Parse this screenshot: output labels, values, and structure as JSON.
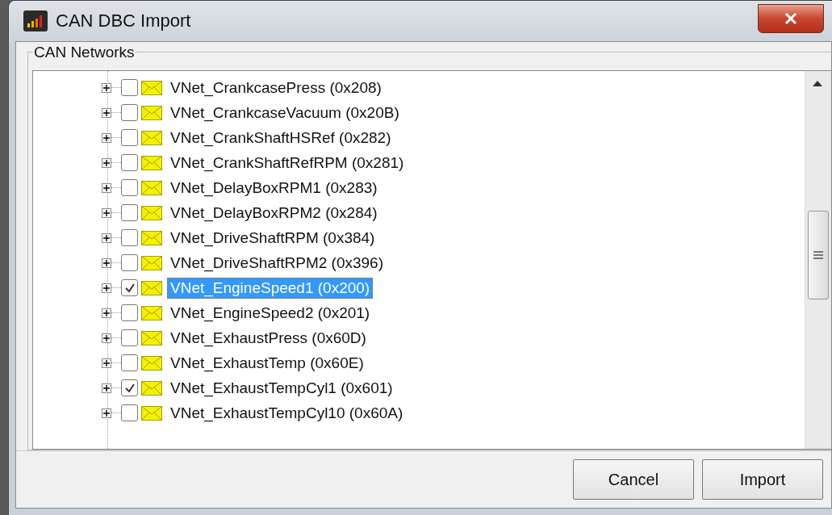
{
  "window": {
    "title": "CAN DBC Import"
  },
  "group": {
    "label": "CAN Networks"
  },
  "tree": {
    "items": [
      {
        "label": "VNet_CrankcasePress (0x208)",
        "checked": false,
        "selected": false,
        "expanded": false
      },
      {
        "label": "VNet_CrankcaseVacuum (0x20B)",
        "checked": false,
        "selected": false,
        "expanded": false
      },
      {
        "label": "VNet_CrankShaftHSRef (0x282)",
        "checked": false,
        "selected": false,
        "expanded": false
      },
      {
        "label": "VNet_CrankShaftRefRPM (0x281)",
        "checked": false,
        "selected": false,
        "expanded": false
      },
      {
        "label": "VNet_DelayBoxRPM1 (0x283)",
        "checked": false,
        "selected": false,
        "expanded": false
      },
      {
        "label": "VNet_DelayBoxRPM2 (0x284)",
        "checked": false,
        "selected": false,
        "expanded": false
      },
      {
        "label": "VNet_DriveShaftRPM (0x384)",
        "checked": false,
        "selected": false,
        "expanded": false
      },
      {
        "label": "VNet_DriveShaftRPM2 (0x396)",
        "checked": false,
        "selected": false,
        "expanded": false
      },
      {
        "label": "VNet_EngineSpeed1 (0x200)",
        "checked": true,
        "selected": true,
        "expanded": false
      },
      {
        "label": "VNet_EngineSpeed2 (0x201)",
        "checked": false,
        "selected": false,
        "expanded": false
      },
      {
        "label": "VNet_ExhaustPress (0x60D)",
        "checked": false,
        "selected": false,
        "expanded": false
      },
      {
        "label": "VNet_ExhaustTemp (0x60E)",
        "checked": false,
        "selected": false,
        "expanded": false
      },
      {
        "label": "VNet_ExhaustTempCyl1 (0x601)",
        "checked": true,
        "selected": false,
        "expanded": false
      },
      {
        "label": "VNet_ExhaustTempCyl10 (0x60A)",
        "checked": false,
        "selected": false,
        "expanded": false
      }
    ]
  },
  "buttons": [
    "Cancel",
    "Import"
  ]
}
